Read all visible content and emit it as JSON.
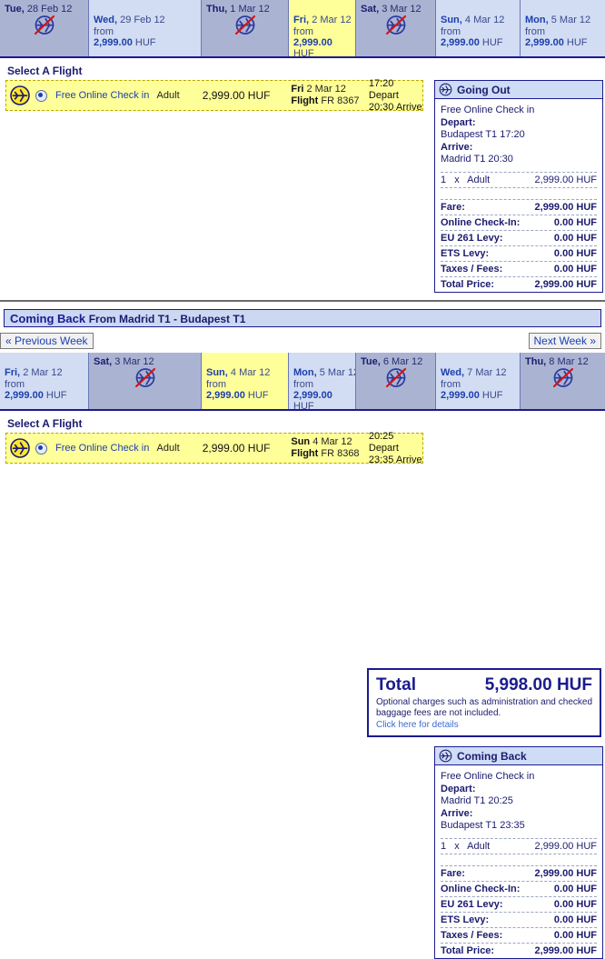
{
  "outbound": {
    "week": [
      {
        "dayname": "Tue,",
        "date": "28 Feb 12",
        "state": "dim",
        "from": "",
        "price": "",
        "currency": ""
      },
      {
        "dayname": "Wed,",
        "date": "29 Feb 12",
        "state": "avail",
        "from": "from",
        "price": "2,999.00",
        "currency": "HUF"
      },
      {
        "dayname": "Thu,",
        "date": "1 Mar 12",
        "state": "dim",
        "from": "",
        "price": "",
        "currency": ""
      },
      {
        "dayname": "Fri,",
        "date": "2 Mar 12",
        "state": "sel",
        "from": "from",
        "price": "2,999.00",
        "currency": "HUF"
      },
      {
        "dayname": "Sat,",
        "date": "3 Mar 12",
        "state": "dim",
        "from": "",
        "price": "",
        "currency": ""
      },
      {
        "dayname": "Sun,",
        "date": "4 Mar 12",
        "state": "avail",
        "from": "from",
        "price": "2,999.00",
        "currency": "HUF"
      },
      {
        "dayname": "Mon,",
        "date": "5 Mar 12",
        "state": "avail",
        "from": "from",
        "price": "2,999.00",
        "currency": "HUF"
      }
    ],
    "select_title": "Select A Flight",
    "flight": {
      "checkin": "Free Online Check in",
      "pax_type": "Adult",
      "price": "2,999.00 HUF",
      "day": "Fri",
      "date": "2 Mar 12",
      "flight_label": "Flight",
      "flight_no": "FR 8367",
      "depart": "17:20 Depart",
      "arrive": "20:30 Arrive"
    },
    "summary": {
      "title": "Going Out",
      "checkin": "Free Online Check in",
      "depart_label": "Depart:",
      "depart_value": "Budapest T1 17:20",
      "arrive_label": "Arrive:",
      "arrive_value": "Madrid T1 20:30",
      "pax_count": "1",
      "pax_times": "x",
      "pax_type": "Adult",
      "pax_price": "2,999.00 HUF",
      "fees": [
        {
          "label": "Fare:",
          "value": "2,999.00 HUF"
        },
        {
          "label": "Online Check-In:",
          "value": "0.00 HUF"
        },
        {
          "label": "EU 261 Levy:",
          "value": "0.00 HUF"
        },
        {
          "label": "ETS Levy:",
          "value": "0.00 HUF"
        },
        {
          "label": "Taxes / Fees:",
          "value": "0.00 HUF"
        },
        {
          "label": "Total Price:",
          "value": "2,999.00 HUF"
        }
      ]
    }
  },
  "inbound": {
    "bar_title": "Coming Back",
    "bar_route": "From Madrid T1 - Budapest T1",
    "prev_week": "« Previous Week",
    "next_week": "Next Week »",
    "week": [
      {
        "dayname": "Fri,",
        "date": "2 Mar 12",
        "state": "avail",
        "from": "from",
        "price": "2,999.00",
        "currency": "HUF"
      },
      {
        "dayname": "Sat,",
        "date": "3 Mar 12",
        "state": "dim",
        "from": "",
        "price": "",
        "currency": ""
      },
      {
        "dayname": "Sun,",
        "date": "4 Mar 12",
        "state": "sel",
        "from": "from",
        "price": "2,999.00",
        "currency": "HUF"
      },
      {
        "dayname": "Mon,",
        "date": "5 Mar 12",
        "state": "avail",
        "from": "from",
        "price": "2,999.00",
        "currency": "HUF"
      },
      {
        "dayname": "Tue,",
        "date": "6 Mar 12",
        "state": "dim",
        "from": "",
        "price": "",
        "currency": ""
      },
      {
        "dayname": "Wed,",
        "date": "7 Mar 12",
        "state": "avail",
        "from": "from",
        "price": "2,999.00",
        "currency": "HUF"
      },
      {
        "dayname": "Thu,",
        "date": "8 Mar 12",
        "state": "dim",
        "from": "",
        "price": "",
        "currency": ""
      }
    ],
    "select_title": "Select A Flight",
    "flight": {
      "checkin": "Free Online Check in",
      "pax_type": "Adult",
      "price": "2,999.00 HUF",
      "day": "Sun",
      "date": "4 Mar 12",
      "flight_label": "Flight",
      "flight_no": "FR 8368",
      "depart": "20:25 Depart",
      "arrive": "23:35 Arrive"
    },
    "summary": {
      "title": "Coming Back",
      "checkin": "Free Online Check in",
      "depart_label": "Depart:",
      "depart_value": "Madrid T1 20:25",
      "arrive_label": "Arrive:",
      "arrive_value": "Budapest T1 23:35",
      "pax_count": "1",
      "pax_times": "x",
      "pax_type": "Adult",
      "pax_price": "2,999.00 HUF",
      "fees": [
        {
          "label": "Fare:",
          "value": "2,999.00 HUF"
        },
        {
          "label": "Online Check-In:",
          "value": "0.00 HUF"
        },
        {
          "label": "EU 261 Levy:",
          "value": "0.00 HUF"
        },
        {
          "label": "ETS Levy:",
          "value": "0.00 HUF"
        },
        {
          "label": "Taxes / Fees:",
          "value": "0.00 HUF"
        },
        {
          "label": "Total Price:",
          "value": "2,999.00 HUF"
        }
      ]
    }
  },
  "total": {
    "label": "Total",
    "amount": "5,998.00  HUF",
    "note": "Optional charges such as administration and checked baggage fees are not included.",
    "link": "Click here for details"
  },
  "colors": {
    "accent": "#1b1b8f",
    "selected": "#ffff99",
    "available": "#d2dcf2",
    "disabled": "#aab4d2",
    "link": "#3a6ad4"
  }
}
